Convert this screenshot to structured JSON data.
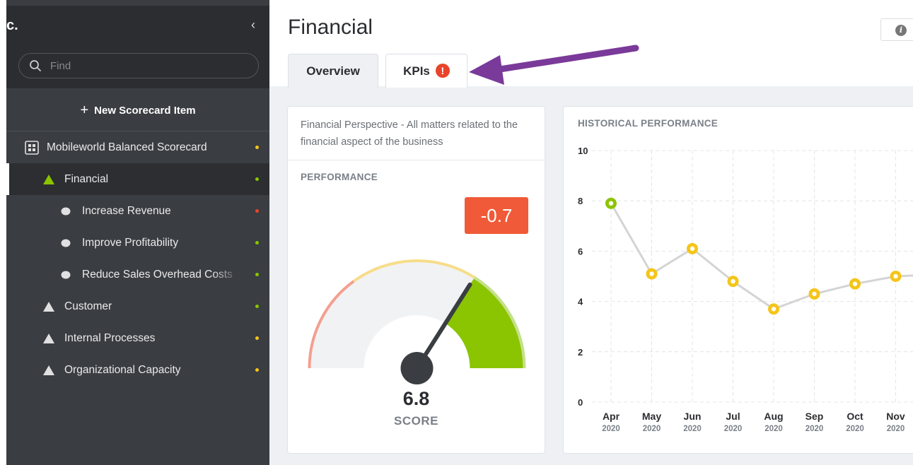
{
  "sidebar": {
    "org_name": "c.",
    "collapse_glyph": "‹",
    "search_placeholder": "Find",
    "new_item_label": "New Scorecard Item",
    "items": [
      {
        "label": "Mobileworld Balanced Scorecard",
        "icon": "scorecard-icon",
        "status_color": "#f5c518"
      },
      {
        "label": "Financial",
        "icon": "triangle-up-icon",
        "status_color": "#8bc400",
        "active": true
      },
      {
        "label": "Increase Revenue",
        "icon": "circle-icon",
        "status_color": "#e8442b"
      },
      {
        "label": "Improve Profitability",
        "icon": "circle-icon",
        "status_color": "#8bc400"
      },
      {
        "label": "Reduce Sales Overhead Costs",
        "icon": "circle-icon",
        "status_color": "#8bc400"
      },
      {
        "label": "Customer",
        "icon": "triangle-up-icon",
        "status_color": "#8bc400"
      },
      {
        "label": "Internal Processes",
        "icon": "triangle-up-icon",
        "status_color": "#f5c518"
      },
      {
        "label": "Organizational Capacity",
        "icon": "triangle-up-icon",
        "status_color": "#f5c518"
      }
    ]
  },
  "main": {
    "title": "Financial",
    "tabs": [
      {
        "label": "Overview",
        "active": true
      },
      {
        "label": "KPIs",
        "alert": "!"
      }
    ],
    "description": "Financial Perspective - All matters related to the financial aspect of the business",
    "performance_label": "PERFORMANCE",
    "change_badge": "-0.7",
    "score_value": "6.8",
    "score_label": "SCORE",
    "historical_label": "HISTORICAL PERFORMANCE"
  },
  "colors": {
    "accent_green": "#8bc400",
    "accent_yellow": "#f5c518",
    "accent_red": "#f05a38",
    "arrow_purple": "#7a3a9a"
  },
  "chart_data": {
    "type": "line",
    "title": "HISTORICAL PERFORMANCE",
    "x": [
      "Apr",
      "May",
      "Jun",
      "Jul",
      "Aug",
      "Sep",
      "Oct",
      "Nov"
    ],
    "x_sub": [
      "2020",
      "2020",
      "2020",
      "2020",
      "2020",
      "2020",
      "2020",
      "2020"
    ],
    "series": [
      {
        "values": [
          7.9,
          5.1,
          6.1,
          4.8,
          3.7,
          4.3,
          4.7,
          5.0
        ]
      }
    ],
    "point_colors": [
      "#8bc400",
      "#f5c518",
      "#f5c518",
      "#f5c518",
      "#f5c518",
      "#f5c518",
      "#f5c518",
      "#f5c518"
    ],
    "ylim": [
      0,
      10
    ],
    "yticks": [
      0,
      2,
      4,
      6,
      8,
      10
    ],
    "grid": true
  },
  "gauge": {
    "value": 6.8,
    "min": 0,
    "max": 10
  }
}
